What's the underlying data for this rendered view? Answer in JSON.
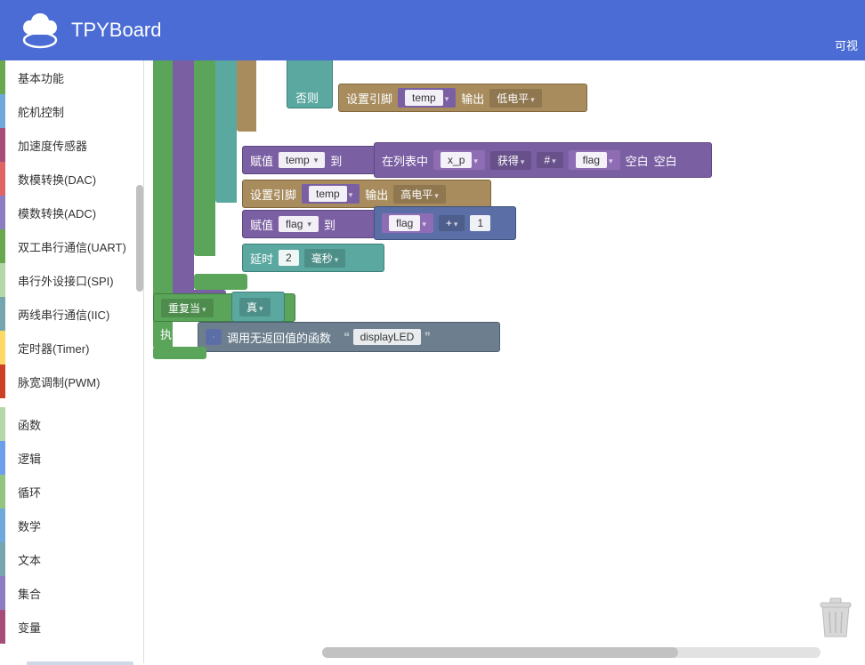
{
  "header": {
    "title": "TPYBoard",
    "right_link": "可视"
  },
  "sidebar": {
    "hardware": [
      {
        "label": "基本功能",
        "color": "#6aa84f"
      },
      {
        "label": "舵机控制",
        "color": "#6fa8dc"
      },
      {
        "label": "加速度传感器",
        "color": "#a64d79"
      },
      {
        "label": "数模转换(DAC)",
        "color": "#e06666"
      },
      {
        "label": "模数转换(ADC)",
        "color": "#8e7cc3"
      },
      {
        "label": "双工串行通信(UART)",
        "color": "#6aa84f"
      },
      {
        "label": "串行外设接口(SPI)",
        "color": "#b6d7a8"
      },
      {
        "label": "两线串行通信(IIC)",
        "color": "#76a5af"
      },
      {
        "label": "定时器(Timer)",
        "color": "#ffd966"
      },
      {
        "label": "脉宽调制(PWM)",
        "color": "#cc4125"
      }
    ],
    "core": [
      {
        "label": "函数",
        "color": "#b6d7a8"
      },
      {
        "label": "逻辑",
        "color": "#6d9eeb"
      },
      {
        "label": "循环",
        "color": "#93c47d"
      },
      {
        "label": "数学",
        "color": "#6fa8dc"
      },
      {
        "label": "文本",
        "color": "#76a5af"
      },
      {
        "label": "集合",
        "color": "#8e7cc3"
      },
      {
        "label": "变量",
        "color": "#a64d79"
      }
    ]
  },
  "blocks": {
    "else_label": "否则",
    "set_pin": "设置引脚",
    "temp_var": "temp",
    "output_label": "输出",
    "low_level": "低电平",
    "high_level": "高电平",
    "assign": "赋值",
    "to_label": "到",
    "in_list": "在列表中",
    "xp_var": "x_p",
    "get_label": "获得",
    "hash": "#",
    "flag_var": "flag",
    "blank": "空白",
    "plus": "+",
    "one": "1",
    "delay_label": "延时",
    "delay_val": "2",
    "ms_label": "毫秒",
    "repeat_label": "重复当",
    "true_label": "真",
    "exec_label": "执行",
    "call_fn": "调用无返回值的函数",
    "fn_name": "displayLED"
  }
}
